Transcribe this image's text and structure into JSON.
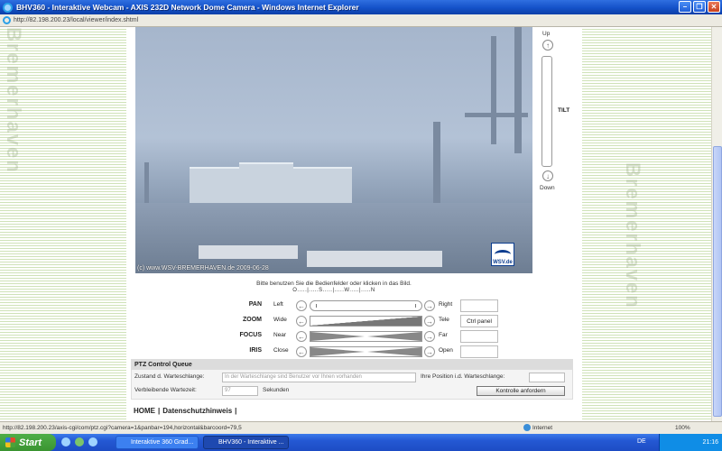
{
  "window": {
    "title": "BHV360 - Interaktive Webcam - AXIS 232D Network Dome Camera - Windows Internet Explorer"
  },
  "address": {
    "url": "http://82.198.200.23/local/viewer/index.shtml"
  },
  "camera": {
    "caption": "(c) www.WSV-BREMERHAVEN.de 2009-06-28",
    "logo_text": "WSV.de"
  },
  "tilt": {
    "up_label": "Up",
    "label": "TILT",
    "down_label": "Down"
  },
  "instructions": {
    "line1": "Bitte benutzen Sie die Bedienfelder oder klicken in das Bild.",
    "line2": "O.....|.....S.....|.....W.....|.....N"
  },
  "controls": {
    "pan": {
      "name": "PAN",
      "left": "Left",
      "right": "Right"
    },
    "zoom": {
      "name": "ZOOM",
      "left": "Wide",
      "right": "Tele",
      "button": "Ctrl panel"
    },
    "focus": {
      "name": "FOCUS",
      "left": "Near",
      "right": "Far"
    },
    "iris": {
      "name": "IRIS",
      "left": "Close",
      "right": "Open"
    }
  },
  "queue": {
    "title": "PTZ Control Queue",
    "status_label": "Zustand d. Warteschlange:",
    "status_value": "In der Warteschlange sind Benutzer vor Ihnen vorhanden",
    "position_label": "Ihre Position i.d. Warteschlange:",
    "position_value": "",
    "wait_label": "Verbleibende Wartezeit:",
    "wait_value": "97",
    "wait_unit": "Sekunden",
    "request_button": "Kontrolle anfordern"
  },
  "footer": {
    "home": "HOME",
    "privacy": "Datenschutzhinweis"
  },
  "status": {
    "url": "http://82.198.200.23/axis-cgi/com/ptz.cgi?camera=1&panbar=194,horizontal&barcoord=79,5",
    "zone": "Internet",
    "zoom": "100%"
  },
  "taskbar": {
    "start": "Start",
    "task1": "Interaktive 360 Grad...",
    "task2": "BHV360 - Interaktive ...",
    "lang": "DE",
    "clock": "21:16"
  }
}
